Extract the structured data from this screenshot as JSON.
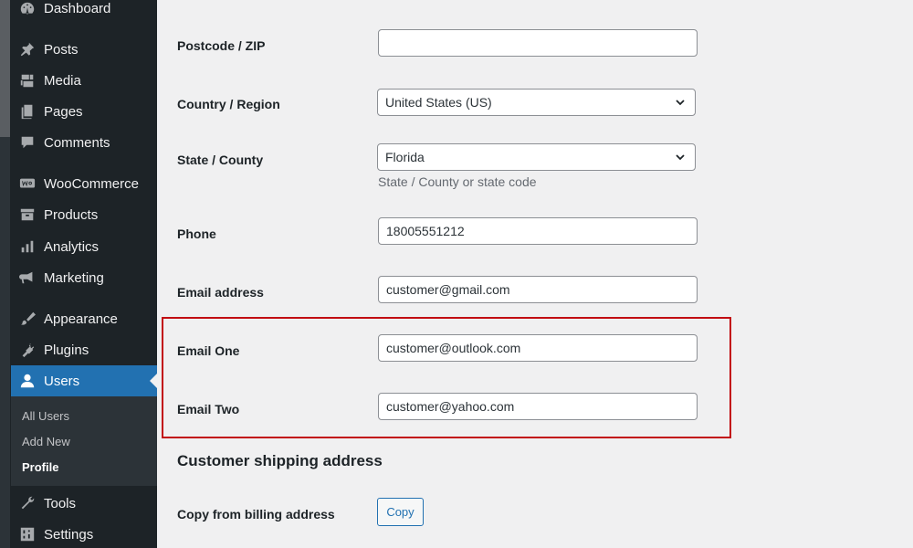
{
  "sidebar": {
    "items": [
      {
        "label": "Dashboard",
        "icon": "dashboard-icon"
      },
      {
        "label": "Posts",
        "icon": "pin-icon"
      },
      {
        "label": "Media",
        "icon": "media-icon"
      },
      {
        "label": "Pages",
        "icon": "page-icon"
      },
      {
        "label": "Comments",
        "icon": "comment-icon"
      },
      {
        "label": "WooCommerce",
        "icon": "woo-icon"
      },
      {
        "label": "Products",
        "icon": "archive-icon"
      },
      {
        "label": "Analytics",
        "icon": "bar-chart-icon"
      },
      {
        "label": "Marketing",
        "icon": "megaphone-icon"
      },
      {
        "label": "Appearance",
        "icon": "brush-icon"
      },
      {
        "label": "Plugins",
        "icon": "plug-icon"
      },
      {
        "label": "Users",
        "icon": "user-icon"
      },
      {
        "label": "Tools",
        "icon": "wrench-icon"
      },
      {
        "label": "Settings",
        "icon": "settings-sliders-icon"
      }
    ],
    "active": "Users",
    "submenu": [
      {
        "label": "All Users"
      },
      {
        "label": "Add New"
      },
      {
        "label": "Profile",
        "current": true
      }
    ]
  },
  "form": {
    "postcode": {
      "label": "Postcode / ZIP",
      "value": ""
    },
    "country": {
      "label": "Country / Region",
      "value": "United States (US)"
    },
    "state": {
      "label": "State / County",
      "value": "Florida",
      "hint": "State / County or state code"
    },
    "phone": {
      "label": "Phone",
      "value": "18005551212"
    },
    "email": {
      "label": "Email address",
      "value": "customer@gmail.com"
    },
    "email_one": {
      "label": "Email One",
      "value": "customer@outlook.com"
    },
    "email_two": {
      "label": "Email Two",
      "value": "customer@yahoo.com"
    }
  },
  "shipping": {
    "heading": "Customer shipping address",
    "copy_label": "Copy from billing address",
    "copy_button": "Copy"
  },
  "colors": {
    "sidebar_bg": "#1d2327",
    "active_bg": "#2271b1",
    "highlight_border": "#c20e12",
    "page_bg": "#f0f0f1"
  }
}
